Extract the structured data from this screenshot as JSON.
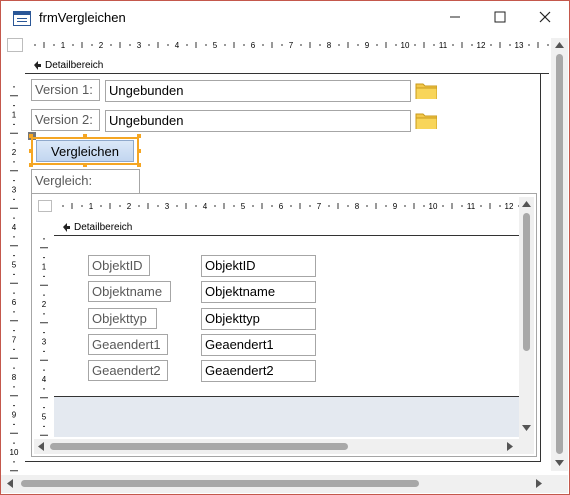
{
  "window": {
    "title": "frmVergleichen"
  },
  "ruler": {
    "top_labels": [
      "1",
      "2",
      "3",
      "4",
      "5",
      "6",
      "7",
      "8",
      "9",
      "10",
      "11",
      "12",
      "13"
    ],
    "side_labels": [
      "1",
      "2",
      "3",
      "4",
      "5",
      "6",
      "7",
      "8",
      "9",
      "10"
    ],
    "inner_top_labels": [
      "1",
      "2",
      "3",
      "4",
      "5",
      "6",
      "7",
      "8",
      "9",
      "10",
      "11",
      "12"
    ],
    "inner_side_labels": [
      "1",
      "2",
      "3",
      "4",
      "5"
    ]
  },
  "section": {
    "outer": "Detailbereich",
    "inner": "Detailbereich"
  },
  "form": {
    "version1_label": "Version 1:",
    "version1_value": "Ungebunden",
    "version2_label": "Version 2:",
    "version2_value": "Ungebunden",
    "compare_button": "Vergleichen",
    "compare_label": "Vergleich:"
  },
  "subform": {
    "fields": [
      {
        "label": "ObjektID",
        "value": "ObjektID"
      },
      {
        "label": "Objektname",
        "value": "Objektname"
      },
      {
        "label": "Objekttyp",
        "value": "Objekttyp"
      },
      {
        "label": "Geaendert1",
        "value": "Geaendert1"
      },
      {
        "label": "Geaendert2",
        "value": "Geaendert2"
      }
    ]
  }
}
